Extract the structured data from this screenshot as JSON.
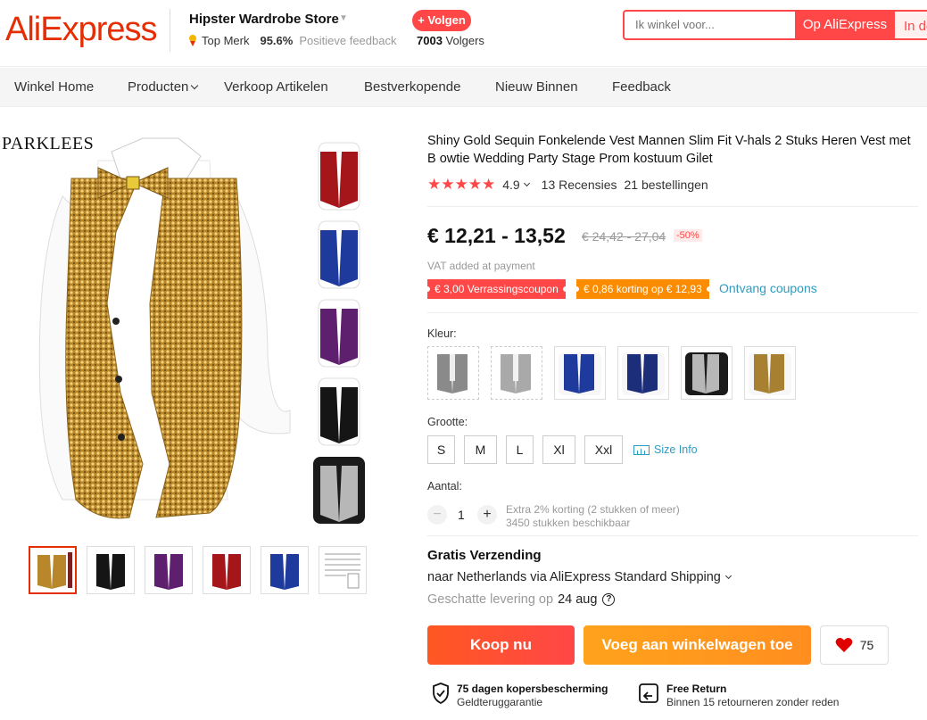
{
  "header": {
    "logo": "AliExpress",
    "store_name": "Hipster Wardrobe Store",
    "top_brand": "Top Merk",
    "feedback_pct": "95.6%",
    "feedback_label": "Positieve feedback",
    "follow_label": "+ Volgen",
    "followers_count": "7003",
    "followers_label": "Volgers",
    "search_placeholder": "Ik winkel voor...",
    "search_ali_label": "Op AliExpress",
    "search_store_label": "In deze winkel"
  },
  "nav": {
    "items": [
      "Winkel Home",
      "Producten",
      "Verkoop Artikelen",
      "Bestverkopende",
      "Nieuw Binnen",
      "Feedback"
    ]
  },
  "gallery": {
    "brand_mark": "PARKLEES"
  },
  "product": {
    "title": "Shiny Gold Sequin Fonkelende Vest Mannen Slim Fit V-hals 2 Stuks Heren Vest met B owtie Wedding Party Stage Prom kostuum Gilet",
    "stars": "★★★★★",
    "rating": "4.9",
    "reviews": "13 Recensies",
    "orders": "21 bestellingen",
    "price": "€ 12,21 - 13,52",
    "old_price": "€ 24,42 - 27,04",
    "discount": "-50%",
    "vat_note": "VAT added at payment",
    "coupon_1": "€ 3,00 Verrassingscoupon",
    "coupon_2": "€ 0,86 korting op € 12,93",
    "get_coupons": "Ontvang coupons",
    "color_label": "Kleur:",
    "size_label": "Grootte:",
    "sizes": [
      "S",
      "M",
      "L",
      "Xl",
      "Xxl"
    ],
    "size_info": "Size Info",
    "qty_label": "Aantal:",
    "qty_minus": "−",
    "qty_plus": "+",
    "qty_value": "1",
    "qty_note_1": "Extra 2% korting (2 stukken of meer)",
    "qty_note_2": "3450 stukken beschikbaar"
  },
  "shipping": {
    "title": "Gratis Verzending",
    "destination": "naar Netherlands via AliExpress Standard Shipping",
    "estimate_label": "Geschatte levering op",
    "estimate_date": "24 aug",
    "help": "?"
  },
  "actions": {
    "buy_now": "Koop nu",
    "add_to_cart": "Voeg aan winkelwagen toe",
    "wishlist_count": "75"
  },
  "guarantees": [
    {
      "title": "75 dagen kopersbescherming",
      "subtitle": "Geldteruggarantie"
    },
    {
      "title": "Free Return",
      "subtitle": "Binnen 15 retourneren zonder reden"
    }
  ],
  "colors": {
    "brand_red": "#ff4747",
    "logo_red": "#e62e04",
    "orange": "#fb8c00",
    "link_blue": "#2e9cc3",
    "swatches": [
      "grey-dashed",
      "silver-dashed",
      "royal-blue",
      "navy-blue",
      "black-silver",
      "gold"
    ]
  }
}
